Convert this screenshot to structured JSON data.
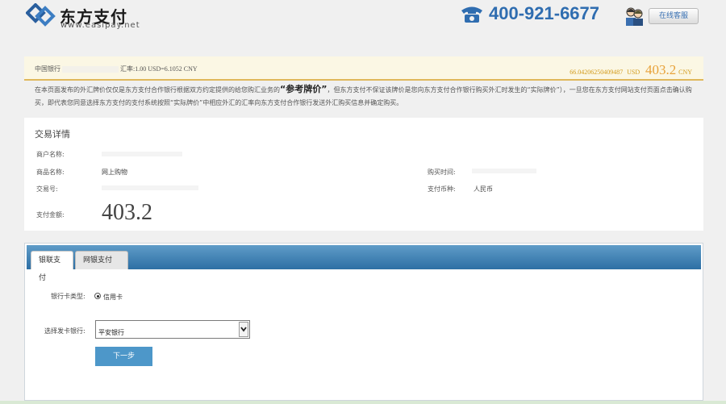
{
  "header": {
    "brand_name": "东方支付",
    "brand_url": "www.easipay.net",
    "phone_icon": "telephone-icon",
    "phone_number": "400-921-6677",
    "service_icon": "customer-service-icon",
    "service_button": "在线客服"
  },
  "rate": {
    "bank_name": "中国银行",
    "rate_text": "汇率:1.00 USD=6.1052 CNY",
    "usd_amount": "66.04206250409487",
    "usd_label": "USD",
    "cny_amount": "403.2",
    "cny_label": "CNY"
  },
  "disclaimer": {
    "part1": "在本页面发布的外汇牌价仅仅是东方支付合作银行根据双方约定提供的给您购汇业务的",
    "emphasis": "“参考牌价”",
    "part2": "，但东方支付不保证该牌价是您向东方支付合作银行购买外汇时发生的“实际牌价”），一旦您在东方支付网站支付页面点击确认购买，即代表您同意选择东方支付的支付系统按照“实际牌价”中相应外汇的汇率向东方支付合作银行发送外汇购买信息并确定购买。"
  },
  "transaction": {
    "title": "交易详情",
    "merchant_label": "商户名称:",
    "product_label": "商品名称:",
    "product_value": "网上购物",
    "trade_no_label": "交易号:",
    "purchase_time_label": "购买时间:",
    "currency_label": "支付币种:",
    "currency_value": "人民币",
    "amount_label": "支付金额:",
    "amount_value": "403.2"
  },
  "payment": {
    "tabs": [
      "银联支付",
      "网银支付"
    ],
    "card_type_label": "银行卡类型:",
    "card_type_option": "信用卡",
    "bank_label": "选择发卡银行:",
    "bank_selected": "平安银行",
    "next_button": "下一步"
  },
  "colors": {
    "accent_blue": "#2f6db0",
    "tab_bar_blue": "#3d7fb4",
    "rate_gold": "#e8a23a",
    "button_blue": "#4d97c9"
  }
}
